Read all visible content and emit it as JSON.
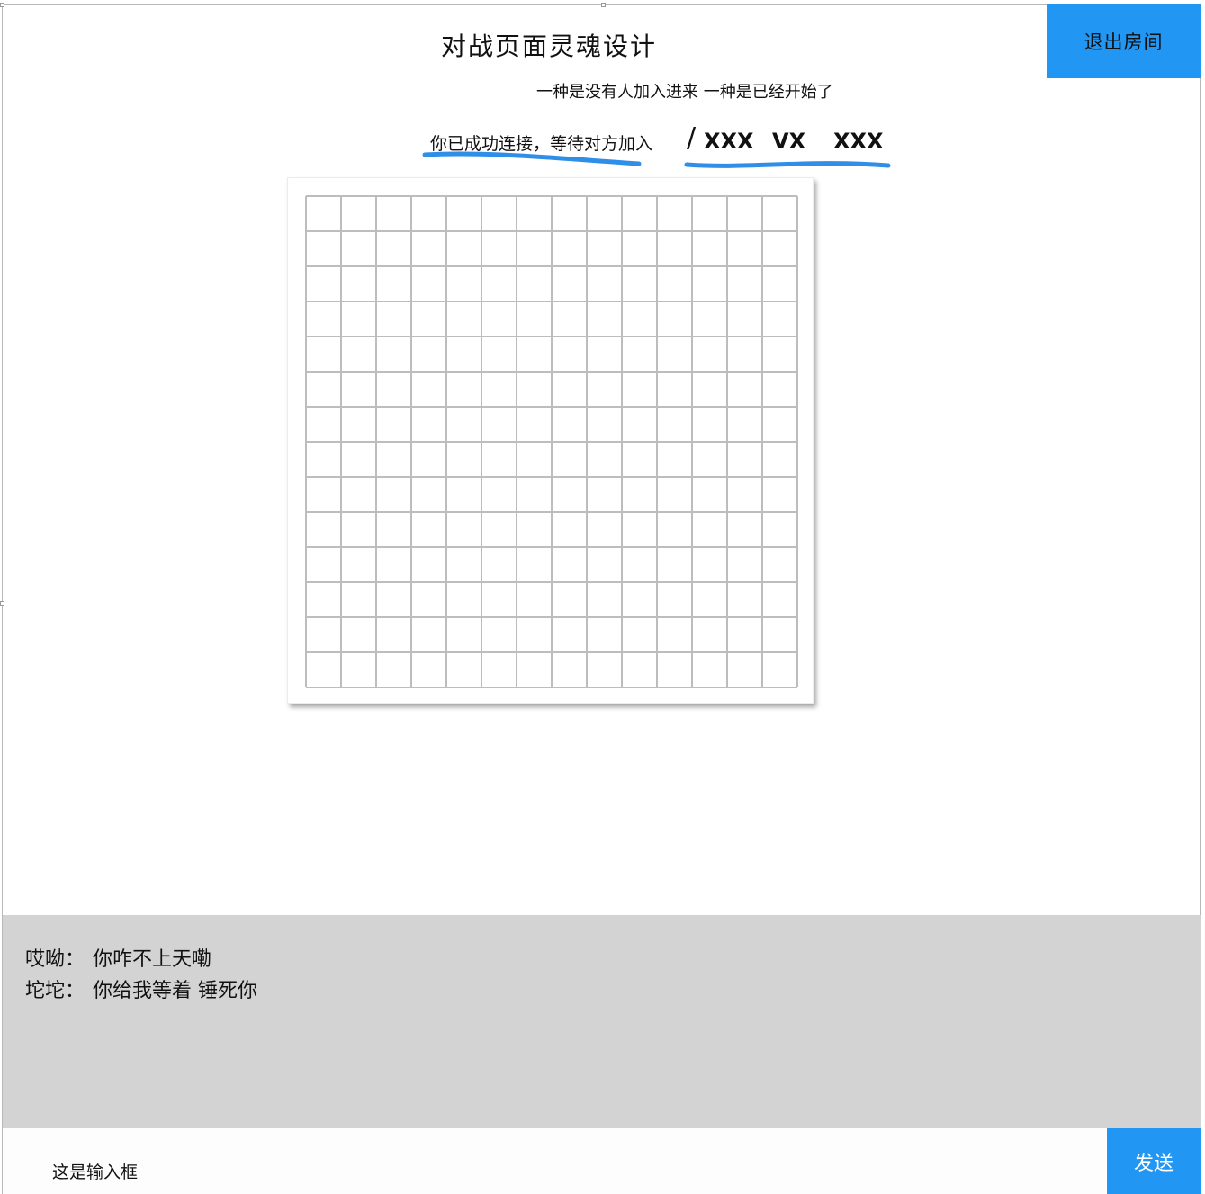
{
  "header": {
    "title": "对战页面灵魂设计",
    "subtitle": "一种是没有人加入进来 一种是已经开始了",
    "status": "你已成功连接，等待对方加入",
    "separator": "/",
    "player_left": "XXX",
    "versus": "VX",
    "player_right": "XXX",
    "exit_label": "退出房间"
  },
  "board": {
    "rows": 14,
    "cols": 14
  },
  "chat": {
    "messages": [
      {
        "sender": "哎呦：",
        "text": "你咋不上天嘞"
      },
      {
        "sender": "坨坨：",
        "text": "你给我等着 锤死你"
      }
    ]
  },
  "input": {
    "placeholder": "这是输入框",
    "send_label": "发送"
  },
  "colors": {
    "accent": "#2196f3",
    "underline": "#2f8ee8",
    "chat_bg": "#d3d3d3",
    "grid_line": "#bdbdbd"
  }
}
